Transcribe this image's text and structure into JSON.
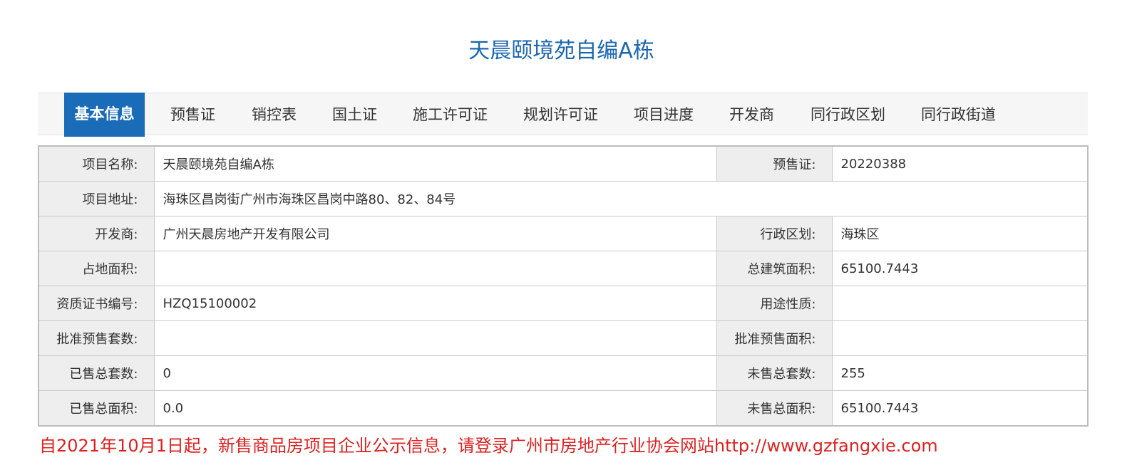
{
  "page": {
    "title": "天晨颐境苑自编A栋"
  },
  "tabs": [
    {
      "label": "基本信息",
      "active": true
    },
    {
      "label": "预售证",
      "active": false
    },
    {
      "label": "销控表",
      "active": false
    },
    {
      "label": "国土证",
      "active": false
    },
    {
      "label": "施工许可证",
      "active": false
    },
    {
      "label": "规划许可证",
      "active": false
    },
    {
      "label": "项目进度",
      "active": false
    },
    {
      "label": "开发商",
      "active": false
    },
    {
      "label": "同行政区划",
      "active": false
    },
    {
      "label": "同行政街道",
      "active": false
    }
  ],
  "info": {
    "project_name": {
      "label": "项目名称:",
      "value": "天晨颐境苑自编A栋"
    },
    "presale_cert": {
      "label": "预售证:",
      "value": "20220388"
    },
    "project_address": {
      "label": "项目地址:",
      "value": "海珠区昌岗街广州市海珠区昌岗中路80、82、84号"
    },
    "developer": {
      "label": "开发商:",
      "value": "广州天晨房地产开发有限公司"
    },
    "district": {
      "label": "行政区划:",
      "value": "海珠区"
    },
    "land_area": {
      "label": "占地面积:",
      "value": ""
    },
    "total_floor_area": {
      "label": "总建筑面积:",
      "value": "65100.7443"
    },
    "qualification_no": {
      "label": "资质证书编号:",
      "value": "HZQ15100002"
    },
    "usage": {
      "label": "用途性质:",
      "value": ""
    },
    "approved_units": {
      "label": "批准预售套数:",
      "value": ""
    },
    "approved_area": {
      "label": "批准预售面积:",
      "value": ""
    },
    "sold_units": {
      "label": "已售总套数:",
      "value": "0"
    },
    "unsold_units": {
      "label": "未售总套数:",
      "value": "255"
    },
    "sold_area": {
      "label": "已售总面积:",
      "value": "0.0"
    },
    "unsold_area": {
      "label": "未售总面积:",
      "value": "65100.7443"
    }
  },
  "notice": "自2021年10月1日起，新售商品房项目企业公示信息，请登录广州市房地产行业协会网站http://www.gzfangxie.com",
  "colors": {
    "title": "#1a66b3",
    "active_tab": "#1a6bb8",
    "label_bg": "#eeeeee",
    "notice": "#e02020"
  }
}
